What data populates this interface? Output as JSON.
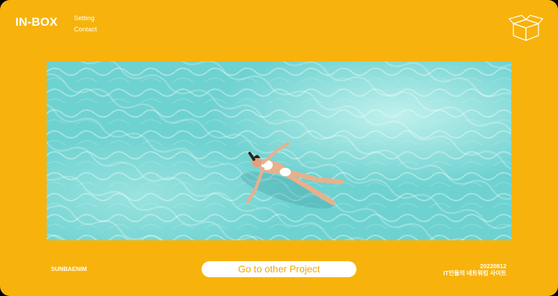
{
  "header": {
    "logo": "IN-BOX",
    "nav": [
      "Setting",
      "Contact"
    ],
    "box_icon": "open-box-icon"
  },
  "hero": {
    "image": "aerial-photo-woman-floating-in-turquoise-water"
  },
  "footer": {
    "left_label": "SUNBAENIM",
    "cta_label": "Go to other Project",
    "date": "20220812",
    "subtitle": "IT인들의 네트워킹 사이트"
  },
  "colors": {
    "background": "#F7B30C",
    "cta_text": "#F3A700",
    "water": "#6FD3D2"
  }
}
